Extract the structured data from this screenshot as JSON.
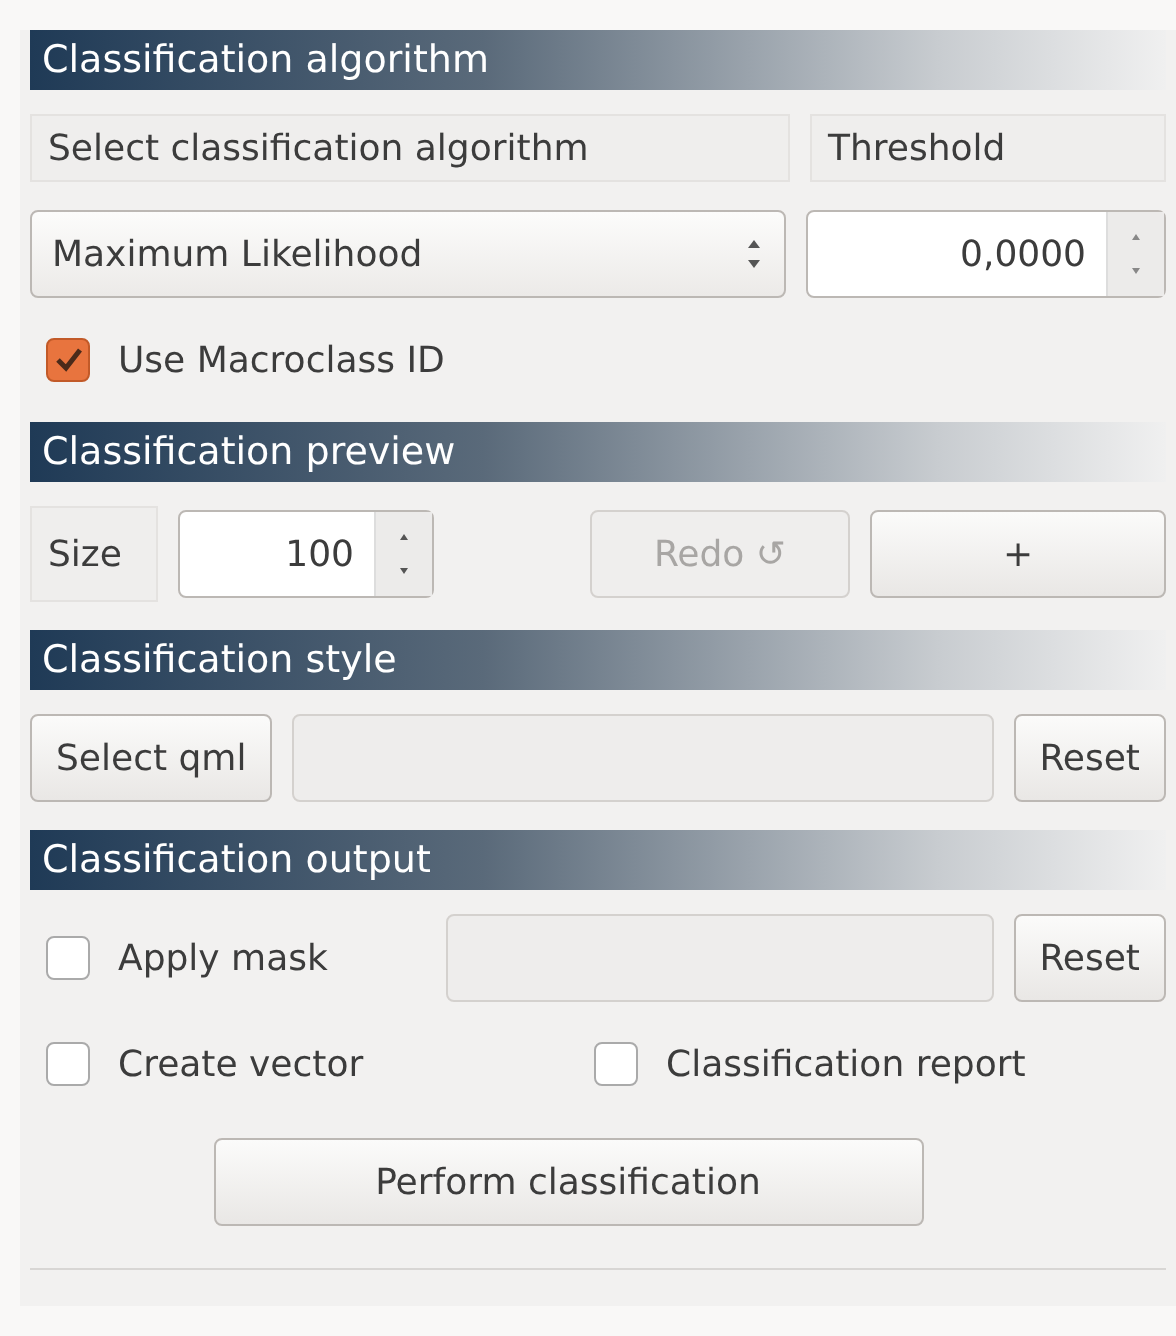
{
  "algorithm": {
    "title": "Classification algorithm",
    "algorithm_label": "Select classification algorithm",
    "threshold_label": "Threshold",
    "algorithm": "Maximum Likelihood",
    "threshold": "0,0000",
    "macroclass": {
      "label": "Use Macroclass ID",
      "checked": true
    }
  },
  "preview": {
    "title": "Classification preview",
    "size_label": "Size",
    "size": "100",
    "redo": {
      "label": "Redo ↺",
      "disabled": true
    },
    "plus": {
      "label": "+",
      "disabled": false
    }
  },
  "style": {
    "title": "Classification style",
    "select_button": "Select qml",
    "reset_button": "Reset"
  },
  "output": {
    "title": "Classification output",
    "apply_mask": {
      "label": "Apply mask",
      "checked": false
    },
    "reset_button": "Reset",
    "create_vector": {
      "label": "Create vector",
      "checked": false
    },
    "report": {
      "label": "Classification report",
      "checked": false
    },
    "perform_button": "Perform classification"
  }
}
